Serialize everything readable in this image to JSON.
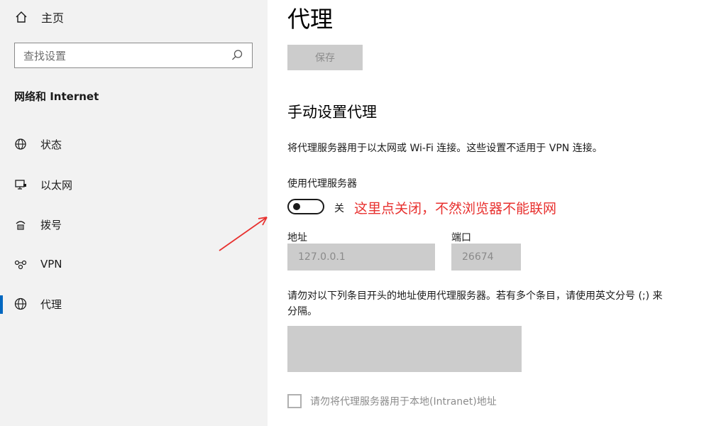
{
  "sidebar": {
    "home_label": "主页",
    "search_placeholder": "查找设置",
    "section_title": "网络和 Internet",
    "items": [
      {
        "label": "状态",
        "icon": "globe-status-icon"
      },
      {
        "label": "以太网",
        "icon": "monitor-ethernet-icon"
      },
      {
        "label": "拨号",
        "icon": "dialup-icon"
      },
      {
        "label": "VPN",
        "icon": "vpn-icon"
      },
      {
        "label": "代理",
        "icon": "globe-icon",
        "active": true
      }
    ]
  },
  "main": {
    "title": "代理",
    "save_label": "保存",
    "manual_title": "手动设置代理",
    "description": "将代理服务器用于以太网或 Wi-Fi 连接。这些设置不适用于 VPN 连接。",
    "use_proxy_label": "使用代理服务器",
    "toggle_state": "关",
    "annotation": "这里点关闭，不然浏览器不能联网",
    "address_label": "地址",
    "address_value": "127.0.0.1",
    "port_label": "端口",
    "port_value": "26674",
    "exceptions_text": "请勿对以下列条目开头的地址使用代理服务器。若有多个条目，请使用英文分号 (;) 来分隔。",
    "exceptions_value": "",
    "local_checkbox_label": "请勿将代理服务器用于本地(Intranet)地址"
  },
  "colors": {
    "accent": "#0067c0",
    "annotation": "#e8312f",
    "sidebar_bg": "#f2f2f2",
    "disabled_bg": "#cccccc"
  }
}
